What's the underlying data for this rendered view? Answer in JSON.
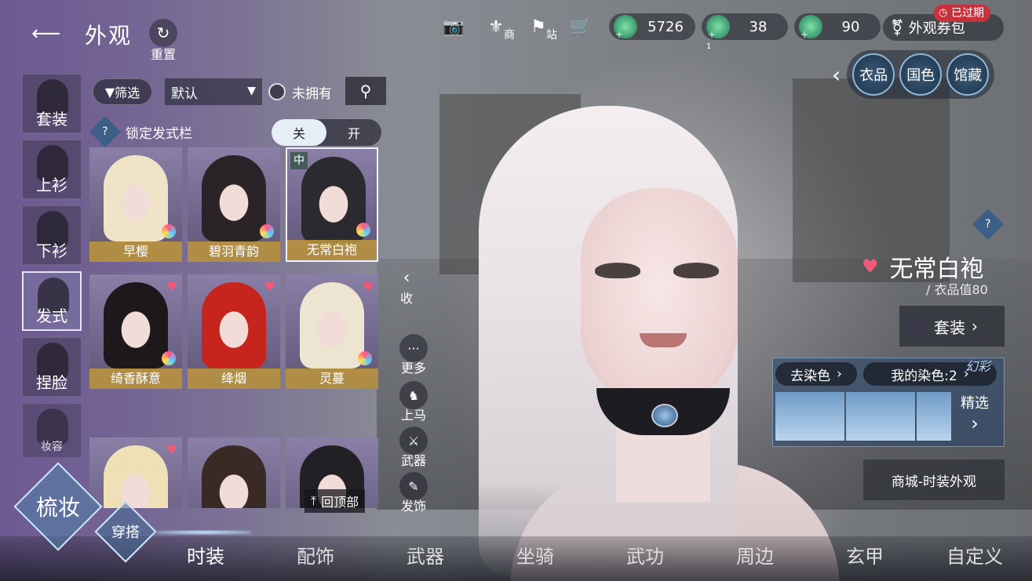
{
  "header": {
    "back_icon": "back-arrow-icon",
    "title": "外观",
    "reset_label": "重置"
  },
  "topbar": {
    "icons": [
      {
        "name": "camera-icon",
        "glyph": "📷",
        "sub": ""
      },
      {
        "name": "merchant-icon",
        "glyph": "⚜",
        "sub": "商"
      },
      {
        "name": "station-icon",
        "glyph": "⚑",
        "sub": "站"
      },
      {
        "name": "cart-icon",
        "glyph": "🛒",
        "sub": ""
      }
    ],
    "currencies": [
      {
        "name": "currency-1",
        "value": "5726"
      },
      {
        "name": "currency-2",
        "value": "38"
      },
      {
        "name": "currency-3",
        "value": "90"
      }
    ],
    "currency_subtext": "1",
    "wardrobe_label": "外观券包",
    "expired_badge": "已过期"
  },
  "category_buttons": [
    "衣品",
    "国色",
    "馆藏"
  ],
  "sidebar": {
    "items": [
      {
        "label": "套装",
        "active": false
      },
      {
        "label": "上衫",
        "active": false
      },
      {
        "label": "下衫",
        "active": false
      },
      {
        "label": "发式",
        "active": true
      },
      {
        "label": "捏脸",
        "active": false
      },
      {
        "label": "妆容",
        "active": false
      }
    ]
  },
  "filters": {
    "filter_label": "筛选",
    "sort_value": "默认",
    "unowned_label": "未拥有"
  },
  "lock_row": {
    "label": "锁定发式栏",
    "toggle_off": "关",
    "toggle_on": "开",
    "selected": "关"
  },
  "hairstyles": [
    {
      "name": "早樱",
      "hair": "#efe4c8",
      "heart": false,
      "tag": "",
      "selected": false,
      "orb": true
    },
    {
      "name": "碧羽青韵",
      "hair": "#2a2428",
      "heart": false,
      "tag": "",
      "selected": false,
      "orb": true
    },
    {
      "name": "无常白袍",
      "hair": "#2b2a30",
      "heart": false,
      "tag": "中",
      "selected": true,
      "orb": true
    },
    {
      "name": "绮香酥意",
      "hair": "#1c181c",
      "heart": true,
      "tag": "",
      "selected": false,
      "orb": true
    },
    {
      "name": "绛烟",
      "hair": "#c8241e",
      "heart": true,
      "tag": "",
      "selected": false,
      "orb": false
    },
    {
      "name": "灵蔓",
      "hair": "#ede4d2",
      "heart": true,
      "tag": "",
      "selected": false,
      "orb": true
    },
    {
      "name": "",
      "hair": "#efe0b8",
      "heart": true,
      "tag": "",
      "selected": false,
      "orb": false
    },
    {
      "name": "",
      "hair": "#3a2a26",
      "heart": false,
      "tag": "",
      "selected": false,
      "orb": false
    },
    {
      "name": "",
      "hair": "#222024",
      "heart": false,
      "tag": "",
      "selected": false,
      "orb": false
    }
  ],
  "to_top_label": "回顶部",
  "side_tools": {
    "collapse_label": "收",
    "items": [
      {
        "label": "更多",
        "icon": "more-icon",
        "glyph": "···"
      },
      {
        "label": "上马",
        "icon": "horse-icon",
        "glyph": "♞"
      },
      {
        "label": "武器",
        "icon": "sword-icon",
        "glyph": "⚔"
      },
      {
        "label": "发饰",
        "icon": "hairpin-icon",
        "glyph": "✎"
      }
    ]
  },
  "item_info": {
    "name": "无常白袍",
    "value_label": "/ 衣品值80",
    "set_label": "套装"
  },
  "dye": {
    "go_label": "去染色",
    "mine_label": "我的染色:2",
    "fancy_tag": "幻彩",
    "select_label": "精选"
  },
  "shop_link": "商城-时装外观",
  "main_modes": {
    "primary": "梳妆",
    "secondary": "穿搭"
  },
  "bottom_tabs": [
    {
      "label": "时装",
      "active": true
    },
    {
      "label": "配饰",
      "active": false
    },
    {
      "label": "武器",
      "active": false
    },
    {
      "label": "坐骑",
      "active": false
    },
    {
      "label": "武功",
      "active": false
    },
    {
      "label": "周边",
      "active": false
    },
    {
      "label": "玄甲",
      "active": false
    },
    {
      "label": "自定义",
      "active": false
    }
  ]
}
